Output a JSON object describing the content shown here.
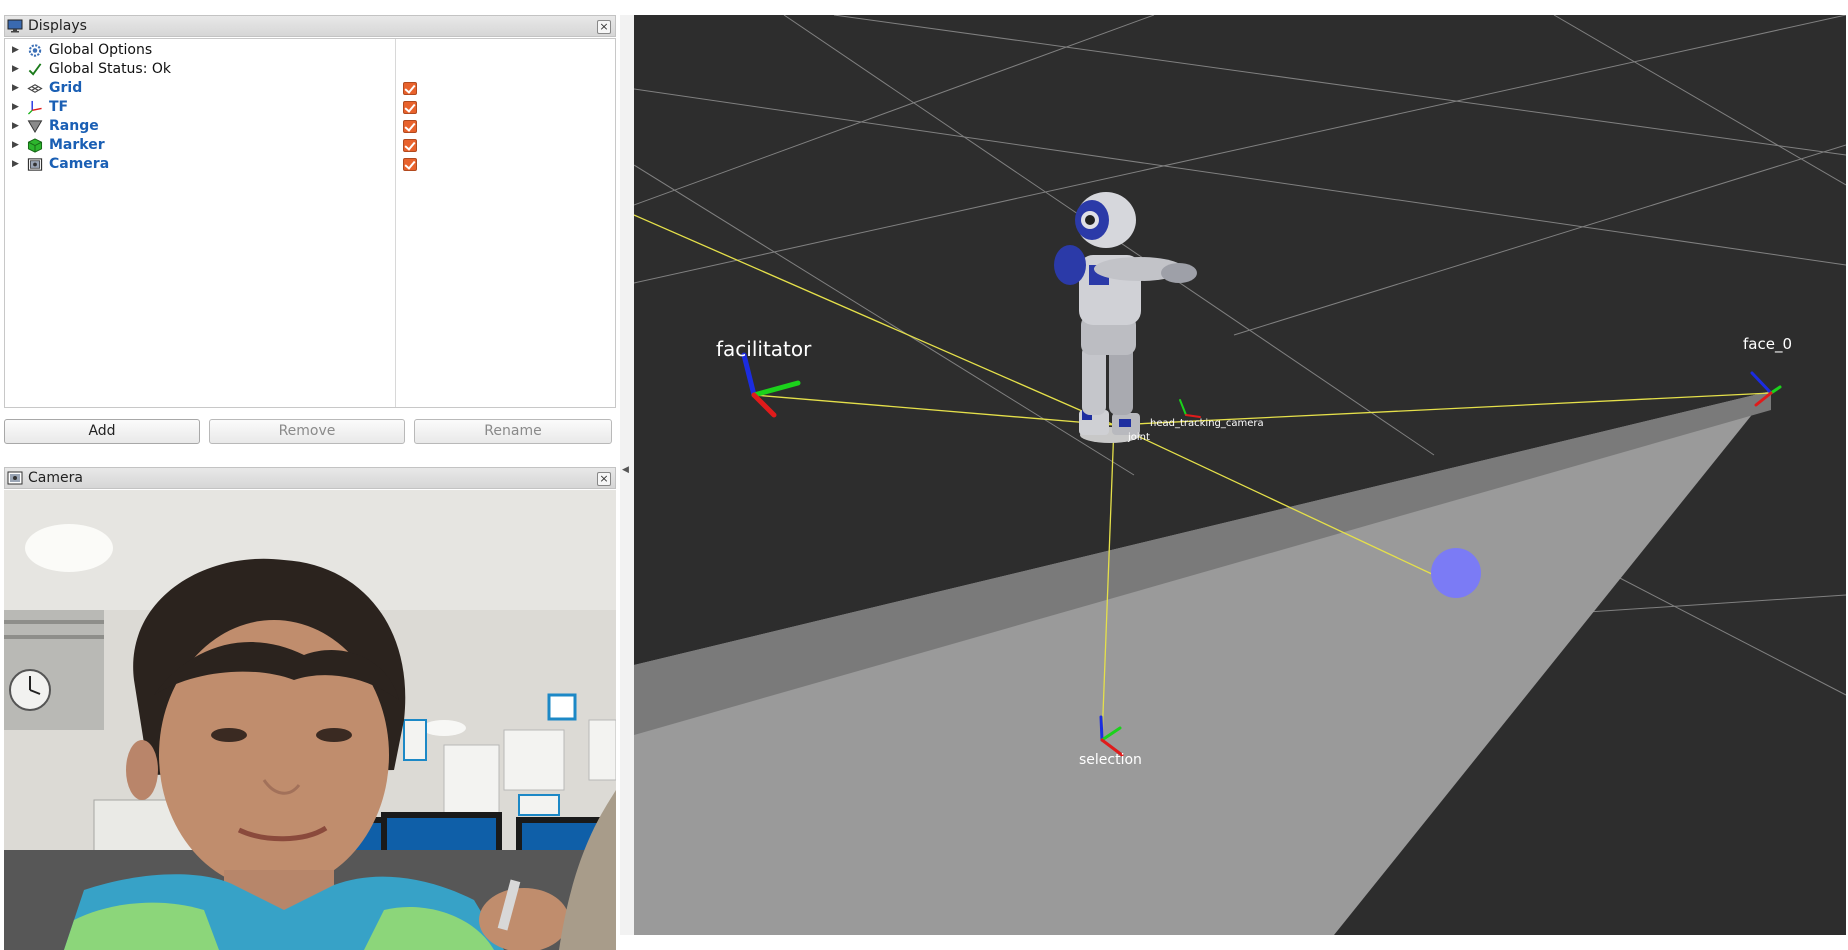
{
  "displays_panel": {
    "title": "Displays",
    "close_glyph": "×",
    "items": [
      {
        "label": "Global Options",
        "icon": "gear-icon",
        "checked": null,
        "highlight": false
      },
      {
        "label": "Global Status: Ok",
        "icon": "checkmark-icon",
        "checked": null,
        "highlight": false
      },
      {
        "label": "Grid",
        "icon": "grid-icon",
        "checked": true,
        "highlight": true
      },
      {
        "label": "TF",
        "icon": "axes-icon",
        "checked": true,
        "highlight": true
      },
      {
        "label": "Range",
        "icon": "cone-icon",
        "checked": true,
        "highlight": true
      },
      {
        "label": "Marker",
        "icon": "cube-icon",
        "checked": true,
        "highlight": true
      },
      {
        "label": "Camera",
        "icon": "camera-icon",
        "checked": true,
        "highlight": true
      }
    ],
    "buttons": {
      "add": "Add",
      "remove": "Remove",
      "rename": "Rename"
    }
  },
  "camera_panel": {
    "title": "Camera",
    "close_glyph": "×"
  },
  "viewport_3d": {
    "frame_labels": {
      "facilitator": "facilitator",
      "face": "face_0",
      "selection": "selection",
      "head_tracking_camera": "head_tracking_camera",
      "base": "joint"
    },
    "colors": {
      "background": "#2d2d2d",
      "grid": "#8a8a8a",
      "range_cone": "#9a9a9a",
      "tf_links": "#e5e04a",
      "marker_sphere": "#7b7bf5",
      "axis_x": "#e01b1b",
      "axis_y": "#1bd21b",
      "axis_z": "#1b2ce0"
    }
  }
}
